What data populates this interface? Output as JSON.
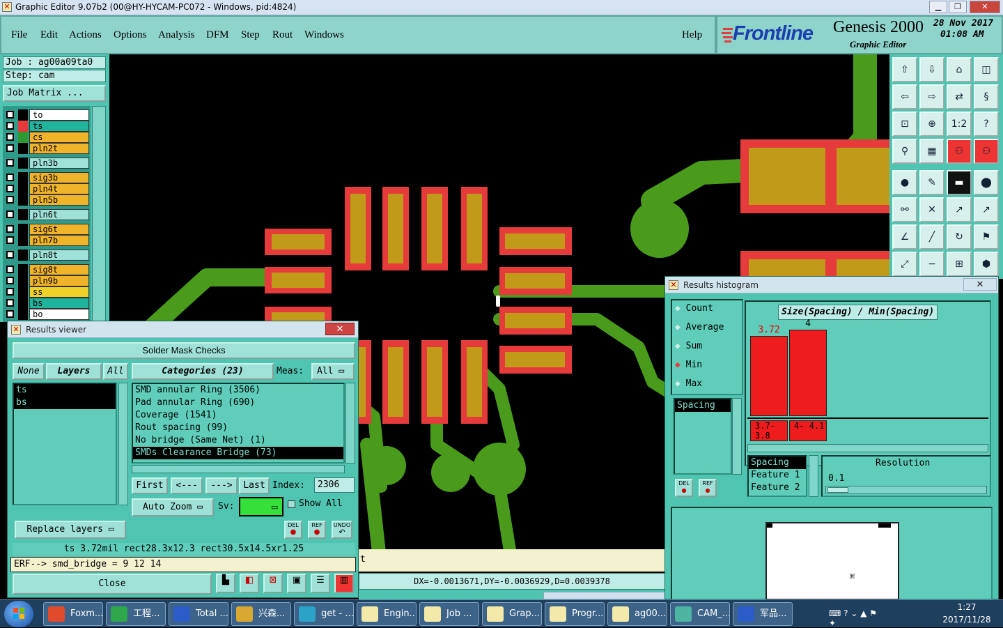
{
  "window": {
    "title": "Graphic Editor 9.07b2 (00@HY-HYCAM-PC072 - Windows, pid:4824)"
  },
  "menubar": {
    "items": [
      "File",
      "Edit",
      "Actions",
      "Options",
      "Analysis",
      "DFM",
      "Step",
      "Rout",
      "Windows"
    ],
    "help": "Help"
  },
  "brand": {
    "logo": "Frontline",
    "product": "Genesis 2000",
    "subtitle": "Graphic Editor",
    "date": "28 Nov 2017",
    "time": "01:08 AM"
  },
  "left_panel": {
    "job_label": "Job : ag00a09ta0",
    "step_label": "Step: cam",
    "job_matrix": "Job Matrix ...",
    "layers": [
      {
        "name": "to",
        "color": "#ffffff",
        "sq": "#000000"
      },
      {
        "name": "ts",
        "color": "#20b49c",
        "sq": "#e53b3b"
      },
      {
        "name": "cs",
        "color": "#f0b42a",
        "sq": "#2f9a2f"
      },
      {
        "name": "pln2t",
        "color": "#f0b42a",
        "sq": "#000000"
      },
      {
        "name": "pln3b",
        "color": "#9fe1d6",
        "sq": "#000000"
      },
      {
        "name": "sig3b",
        "color": "#f0b42a",
        "sq": "#000000"
      },
      {
        "name": "pln4t",
        "color": "#f0b42a",
        "sq": "#000000"
      },
      {
        "name": "pln5b",
        "color": "#f0b42a",
        "sq": "#000000"
      },
      {
        "name": "pln6t",
        "color": "#9fe1d6",
        "sq": "#000000"
      },
      {
        "name": "sig6t",
        "color": "#f0b42a",
        "sq": "#000000"
      },
      {
        "name": "pln7b",
        "color": "#f0b42a",
        "sq": "#000000"
      },
      {
        "name": "pln8t",
        "color": "#9fe1d6",
        "sq": "#000000"
      },
      {
        "name": "sig8t",
        "color": "#f0b42a",
        "sq": "#000000"
      },
      {
        "name": "pln9b",
        "color": "#f0b42a",
        "sq": "#000000"
      },
      {
        "name": "ss",
        "color": "#f0d12a",
        "sq": "#000000"
      },
      {
        "name": "bs",
        "color": "#20b49c",
        "sq": "#000000"
      },
      {
        "name": "bo",
        "color": "#ffffff",
        "sq": "#000000"
      }
    ]
  },
  "results_viewer": {
    "title": "Results viewer",
    "header": "Solder Mask Checks",
    "none_btn": "None",
    "layers_btn": "Layers",
    "all_btn": "All",
    "categories_btn": "Categories (23)",
    "meas_label": "Meas:",
    "meas_value": "All",
    "layer_items": [
      "ts",
      "bs"
    ],
    "categories": [
      "SMD annular Ring (3506)",
      "Pad annular Ring (690)",
      "Coverage (1541)",
      "Rout spacing (99)",
      "No bridge (Same Net) (1)",
      "SMDs Clearance Bridge (73)"
    ],
    "first_btn": "First",
    "prev_btn": "<---",
    "next_btn": "--->",
    "last_btn": "Last",
    "index_label": "Index:",
    "index_value": "2306",
    "auto_zoom": "Auto Zoom",
    "sv_label": "Sv:",
    "show_all": "Show All",
    "replace_layers": "Replace layers",
    "del": "DEL",
    "ref": "REF",
    "undo": "UNDO",
    "info_line": "ts 3.72mil   rect28.3x12.3   rect30.5x14.5xr1.25",
    "erf_line": "ERF--> smd_bridge = 9 12 14",
    "close_btn": "Close"
  },
  "status": {
    "coords": "DX=-0.0013671,DY=-0.0036929,D=0.0039378",
    "partial": "t"
  },
  "histogram": {
    "title": "Results histogram",
    "modes": [
      "Count",
      "Average",
      "Sum",
      "Min",
      "Max"
    ],
    "selected_mode": "Min",
    "heading": "Size(Spacing) / Min(Spacing)",
    "measure_item": "Spacing",
    "features": [
      "Spacing",
      "Feature 1",
      "Feature 2"
    ],
    "resolution_label": "Resolution",
    "resolution_value": "0.1",
    "del": "DEL",
    "ref": "REF",
    "bars": [
      {
        "label": "3.72",
        "value": 3.72,
        "range": "3.7- 3.8"
      },
      {
        "label": "4",
        "value": 4,
        "range": "4- 4.1"
      }
    ]
  },
  "taskbar": {
    "items": [
      "Foxm...",
      "工程...",
      "Total ...",
      "兴森...",
      "get - ...",
      "Engin...",
      "Job ...",
      "Grap...",
      "Progr...",
      "ag00...",
      "CAM_...",
      "军品..."
    ],
    "time": "1:27",
    "date": "2017/11/28"
  }
}
